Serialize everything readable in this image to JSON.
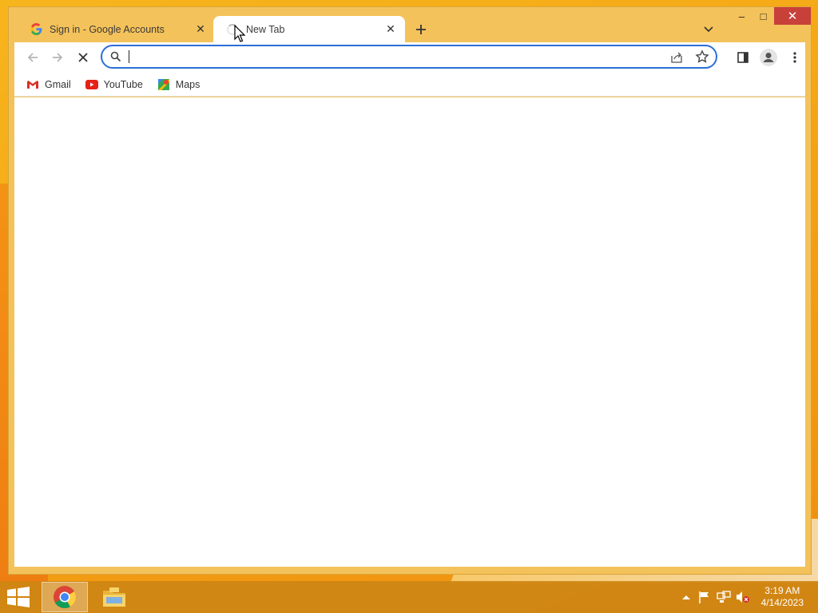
{
  "tabs": [
    {
      "title": "Sign in - Google Accounts",
      "favicon": "google-icon",
      "active": false
    },
    {
      "title": "New Tab",
      "favicon": "loading-spinner-icon",
      "active": true
    }
  ],
  "window_controls": {
    "minimize": "–",
    "maximize": "□",
    "close": "✕"
  },
  "toolbar": {
    "back": "back-arrow-icon",
    "forward": "forward-arrow-icon",
    "stop": "stop-loading-icon",
    "omnibox": {
      "value": "",
      "placeholder": ""
    },
    "side_panel": "side-panel-icon",
    "profile": "profile-avatar-icon",
    "menu": "kebab-menu-icon"
  },
  "bookmarks": [
    {
      "label": "Gmail",
      "icon": "gmail-icon"
    },
    {
      "label": "YouTube",
      "icon": "youtube-icon"
    },
    {
      "label": "Maps",
      "icon": "maps-icon"
    }
  ],
  "taskbar": {
    "clock_time": "3:19 AM",
    "clock_date": "4/14/2023",
    "items": [
      "chrome-icon",
      "file-explorer-icon"
    ]
  },
  "colors": {
    "accent": "#2a6fd6",
    "window_frame": "#f4c25a",
    "close_button": "#c7403a",
    "desktop": "#f5a716"
  }
}
